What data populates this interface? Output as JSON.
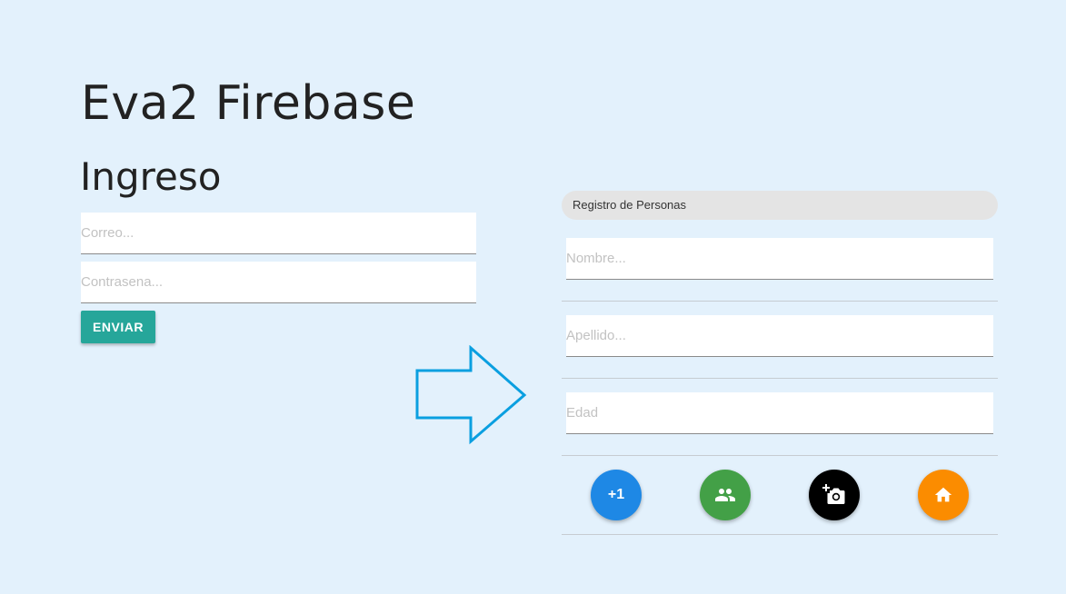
{
  "header": {
    "title": "Eva2 Firebase"
  },
  "login": {
    "title": "Ingreso",
    "email_placeholder": "Correo...",
    "password_placeholder": "Contrasena...",
    "submit_label": "ENVIAR"
  },
  "register": {
    "chip_label": "Registro de Personas",
    "name_placeholder": "Nombre...",
    "lastname_placeholder": "Apellido...",
    "age_placeholder": "Edad"
  },
  "actions": [
    {
      "name": "add-button",
      "label": "+1",
      "icon": "plus-one",
      "color": "#1e88e5"
    },
    {
      "name": "people-button",
      "icon": "people-icon",
      "color": "#43a047"
    },
    {
      "name": "add-photo-button",
      "icon": "add-photo-icon",
      "color": "#000000"
    },
    {
      "name": "home-button",
      "icon": "home-icon",
      "color": "#fb8c00"
    }
  ],
  "colors": {
    "background": "#e3f1fc",
    "submit": "#26a69a",
    "arrow": "#0a9fe0"
  }
}
